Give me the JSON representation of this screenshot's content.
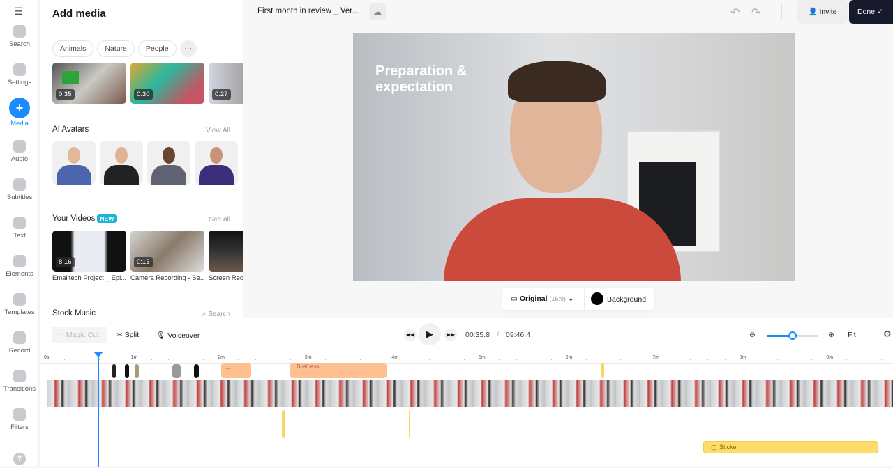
{
  "rail": {
    "items": [
      {
        "label": "Search",
        "icon": "search-icon"
      },
      {
        "label": "Settings",
        "icon": "gear-icon"
      },
      {
        "label": "Media",
        "icon": "plus-icon",
        "active": true
      },
      {
        "label": "Audio",
        "icon": "music-icon"
      },
      {
        "label": "Subtitles",
        "icon": "subtitles-icon"
      },
      {
        "label": "Text",
        "icon": "text-icon"
      },
      {
        "label": "Elements",
        "icon": "elements-icon"
      },
      {
        "label": "Templates",
        "icon": "templates-icon"
      },
      {
        "label": "Record",
        "icon": "camera-icon"
      },
      {
        "label": "Transitions",
        "icon": "transitions-icon"
      },
      {
        "label": "Filters",
        "icon": "filters-icon"
      }
    ],
    "help": "?"
  },
  "panel": {
    "title": "Add media",
    "chips": [
      "Animals",
      "Nature",
      "People"
    ],
    "more": "···",
    "stock": [
      {
        "duration": "0:35"
      },
      {
        "duration": "0:30"
      },
      {
        "duration": "0:27"
      }
    ],
    "avatars": {
      "title": "AI Avatars",
      "link": "View All"
    },
    "your_videos": {
      "title": "Your Videos",
      "badge": "NEW",
      "link": "See all",
      "items": [
        {
          "duration": "8:16",
          "name": "Emailtech Project _ Epi..."
        },
        {
          "duration": "0:13",
          "name": "Camera Recording - Se..."
        },
        {
          "duration": "",
          "name": "Screen Reco"
        }
      ]
    },
    "music": {
      "title": "Stock Music",
      "search": "Search"
    }
  },
  "header": {
    "title": "First month in review _ Ver...",
    "invite": "Invite",
    "done": "Done ✓"
  },
  "preview": {
    "overlay_line1": "Preparation &",
    "overlay_line2": "expectation",
    "ratio": "Original",
    "ratio_sub": "(16:9)",
    "background": "Background"
  },
  "timeline": {
    "magic_cut": "Magic Cut",
    "split": "Split",
    "voiceover": "Voiceover",
    "current_time": "00:35.8",
    "separator": "/",
    "total_time": "09:46.4",
    "fit": "Fit",
    "zoom_level": 0.5,
    "ruler": [
      "0s",
      "1m",
      "2m",
      "3m",
      "4m",
      "5m",
      "6m",
      "7m",
      "8m",
      "9m"
    ],
    "clip_text": "Business",
    "clip_small": "...",
    "sticker": "Sticker"
  },
  "colors": {
    "accent": "#1a8cff",
    "done_bg": "#161a2c",
    "sticker": "#fcdc6a",
    "text_clip": "#ffc08f"
  }
}
